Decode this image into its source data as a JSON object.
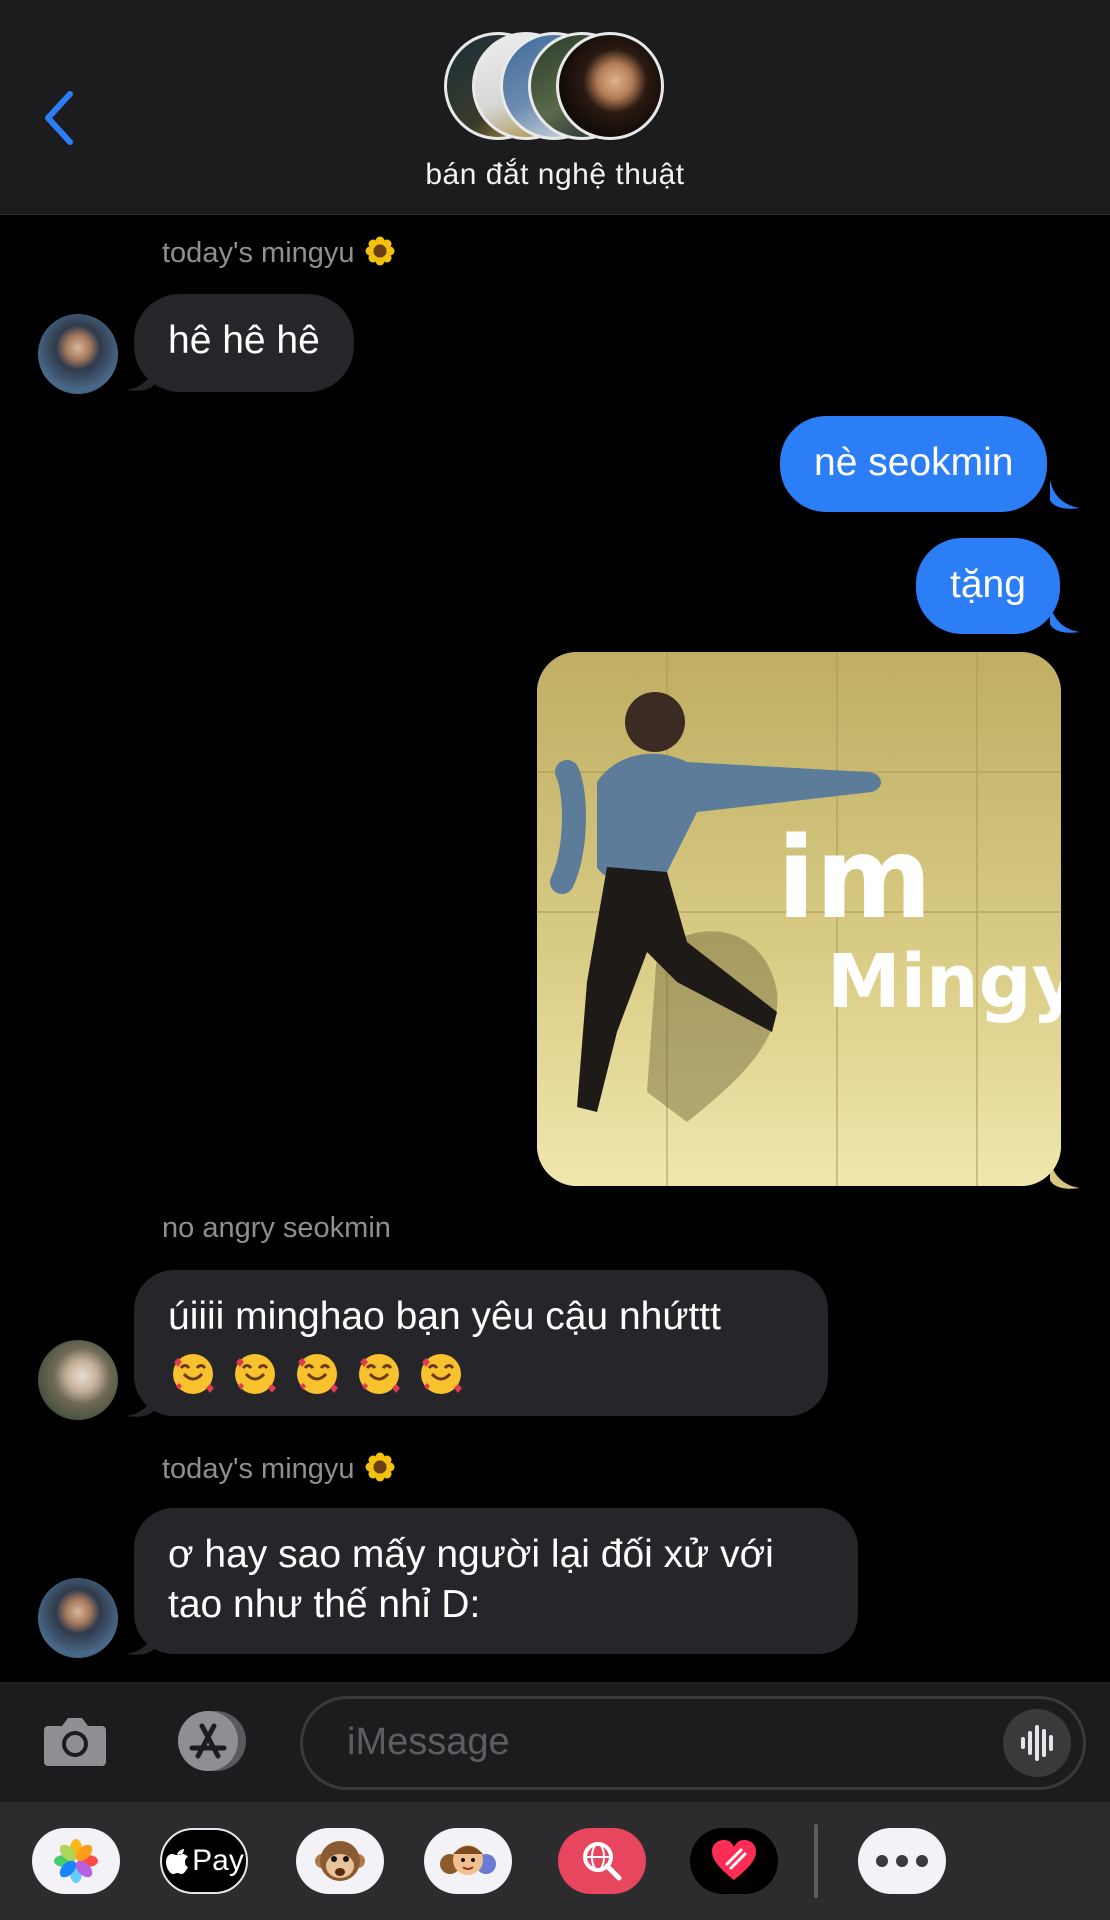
{
  "header": {
    "group_name": "bán đắt nghệ thuật",
    "back_icon": "chevron-left-icon"
  },
  "messages": [
    {
      "sender": "today's mingyu",
      "sender_emoji": "sunflower-icon",
      "text": "hê hê hê"
    },
    {
      "text": "nè seokmin"
    },
    {
      "text": "tặng"
    },
    {
      "media_caption_line1": "im",
      "media_caption_line2": "Mingy"
    },
    {
      "sender": "no angry seokmin",
      "text": "úiiii minghao bạn yêu cậu nhứttt",
      "emoji": "smiling-face-with-hearts-icon"
    },
    {
      "sender": "today's mingyu",
      "sender_emoji": "sunflower-icon",
      "text_line1": "ơ hay sao mấy người lại đối xử với",
      "text_line2": "tao như thế nhỉ D:"
    }
  ],
  "input": {
    "placeholder": "iMessage"
  },
  "apps": [
    {
      "name": "photos-app-icon"
    },
    {
      "name": "apple-pay-app-icon",
      "label": "Pay"
    },
    {
      "name": "animoji-app-icon"
    },
    {
      "name": "memoji-app-icon"
    },
    {
      "name": "web-search-app-icon"
    },
    {
      "name": "digital-touch-app-icon"
    },
    {
      "name": "more-apps-icon"
    }
  ],
  "colors": {
    "accent": "#2c7ef7",
    "incoming": "#26252a",
    "header": "#1c1c1e"
  }
}
